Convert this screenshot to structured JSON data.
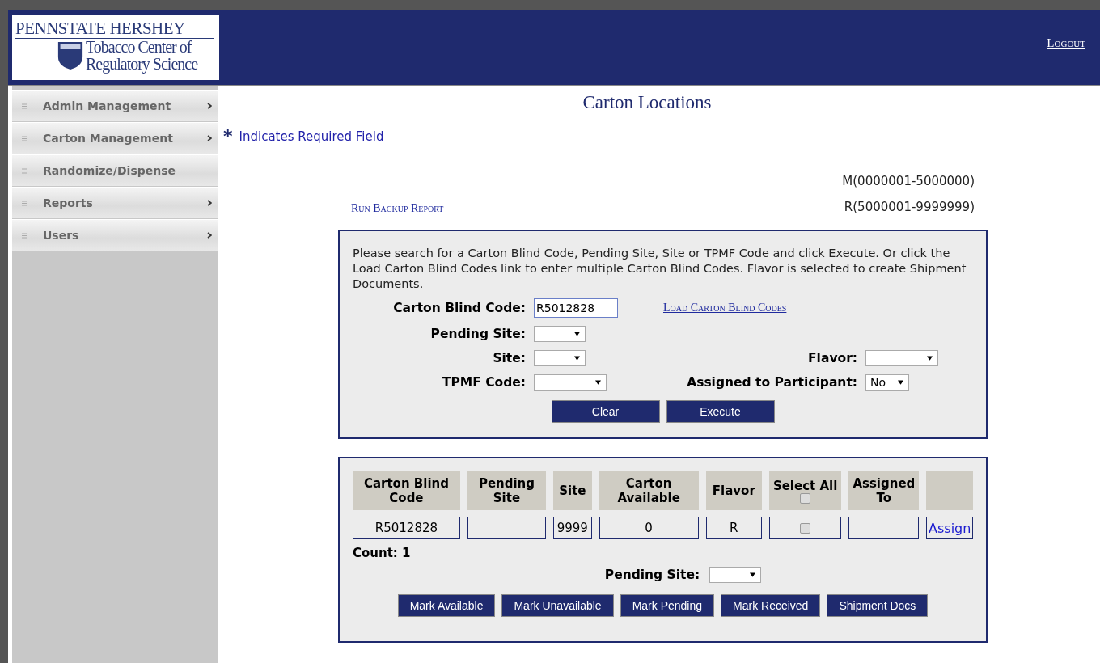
{
  "header": {
    "logo": {
      "brand": "PENNSTATE HERSHEY",
      "line1": "Tobacco Center of",
      "line2": "Regulatory Science"
    },
    "logout": "Logout"
  },
  "sidebar": {
    "items": [
      {
        "label": "Admin Management",
        "has_submenu": true
      },
      {
        "label": "Carton Management",
        "has_submenu": true
      },
      {
        "label": "Randomize/Dispense",
        "has_submenu": false
      },
      {
        "label": "Reports",
        "has_submenu": true
      },
      {
        "label": "Users",
        "has_submenu": true
      }
    ]
  },
  "page_title": "Carton Locations",
  "required_note": {
    "mark": "*",
    "text": "Indicates Required Field"
  },
  "ranges": [
    "M(0000001-5000000)",
    "R(5000001-9999999)"
  ],
  "backup_link": "Run Backup Report",
  "search": {
    "instructions": "Please search for a Carton Blind Code, Pending Site, Site or TPMF Code and click Execute. Or click the Load Carton Blind Codes link to enter multiple Carton Blind Codes. Flavor is selected to create Shipment Documents.",
    "rows": [
      {
        "left": {
          "kind": "text",
          "label": "Carton Blind Code:",
          "value": "R5012828"
        },
        "right": {
          "kind": "link",
          "label": "Load Carton Blind Codes"
        }
      },
      {
        "left": {
          "kind": "select",
          "label": "Pending Site:"
        }
      },
      {
        "left": {
          "kind": "select",
          "label": "Site:"
        },
        "right": {
          "kind": "select",
          "label": "Flavor:"
        }
      },
      {
        "left": {
          "kind": "select",
          "label": "TPMF Code:"
        },
        "right": {
          "kind": "select",
          "label": "Assigned to Participant:",
          "value": "No"
        }
      }
    ],
    "buttons": [
      "Clear",
      "Execute"
    ]
  },
  "results": {
    "columns": [
      {
        "label": "Carton Blind Code"
      },
      {
        "label": "Pending Site"
      },
      {
        "label": "Site"
      },
      {
        "label": "Carton Available"
      },
      {
        "label": "Flavor"
      },
      {
        "label": "Select All",
        "checked": false
      },
      {
        "label": "Assigned To"
      },
      {}
    ],
    "rows": [
      {
        "cells": [
          {
            "kind": "text",
            "value": "R5012828"
          },
          {
            "kind": "text"
          },
          {
            "kind": "text",
            "value": "9999"
          },
          {
            "kind": "text",
            "value": "0"
          },
          {
            "kind": "text",
            "value": "R"
          },
          {
            "kind": "checkbox",
            "checked": false
          },
          {
            "kind": "text"
          },
          {
            "kind": "link",
            "value": "Assign"
          }
        ]
      }
    ],
    "count": "Count: 1",
    "pending_site_label": "Pending Site:",
    "buttons": [
      "Mark Available",
      "Mark Unavailable",
      "Mark Pending",
      "Mark Received",
      "Shipment Docs"
    ]
  }
}
